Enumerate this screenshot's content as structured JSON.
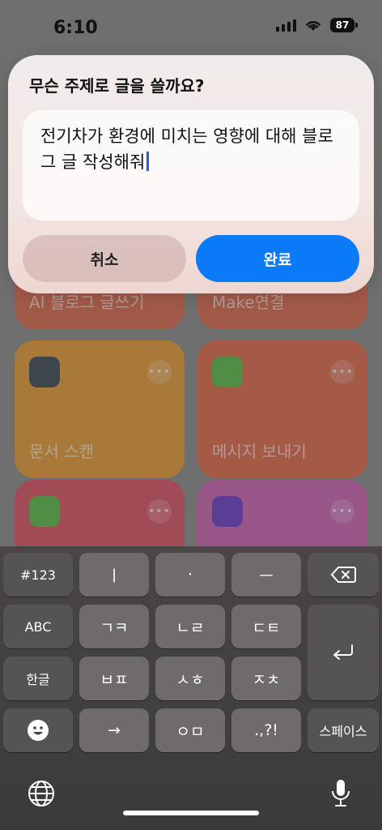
{
  "status": {
    "time": "6:10",
    "battery": "87"
  },
  "dialog": {
    "title": "무슨 주제로 글을 쓸까요?",
    "text_line1": "전기차가 환경에 미치는 영향에 대해 블로",
    "text_line2": "그 글 작성해줘",
    "cancel_label": "취소",
    "done_label": "완료"
  },
  "tiles": [
    {
      "label": "AI 블로그 글쓰기",
      "color": "#d96a4f"
    },
    {
      "label": "Make연결",
      "color": "#d96a4f"
    },
    {
      "label": "문서 스캔",
      "color": "#e39a3a",
      "icon": "folder-icon"
    },
    {
      "label": "메시지 보내기",
      "color": "#dd6a4c",
      "icon": "messages-icon"
    },
    {
      "label": "",
      "color": "#d85466",
      "icon": "messages-icon"
    },
    {
      "label": "",
      "color": "#c965b2",
      "icon": "sparkle-app-icon"
    }
  ],
  "keyboard": {
    "row1": [
      "#123",
      "ㅣ",
      "·",
      "ㅡ"
    ],
    "row2": [
      "ABC",
      "ㄱㅋ",
      "ㄴㄹ",
      "ㄷㅌ"
    ],
    "row3": [
      "한글",
      "ㅂㅍ",
      "ㅅㅎ",
      "ㅈㅊ"
    ],
    "row4": [
      "→",
      "ㅇㅁ",
      ".,?!",
      "스페이스"
    ]
  },
  "colors": {
    "accent": "#0a7af8",
    "caret": "#2b5bd7"
  }
}
